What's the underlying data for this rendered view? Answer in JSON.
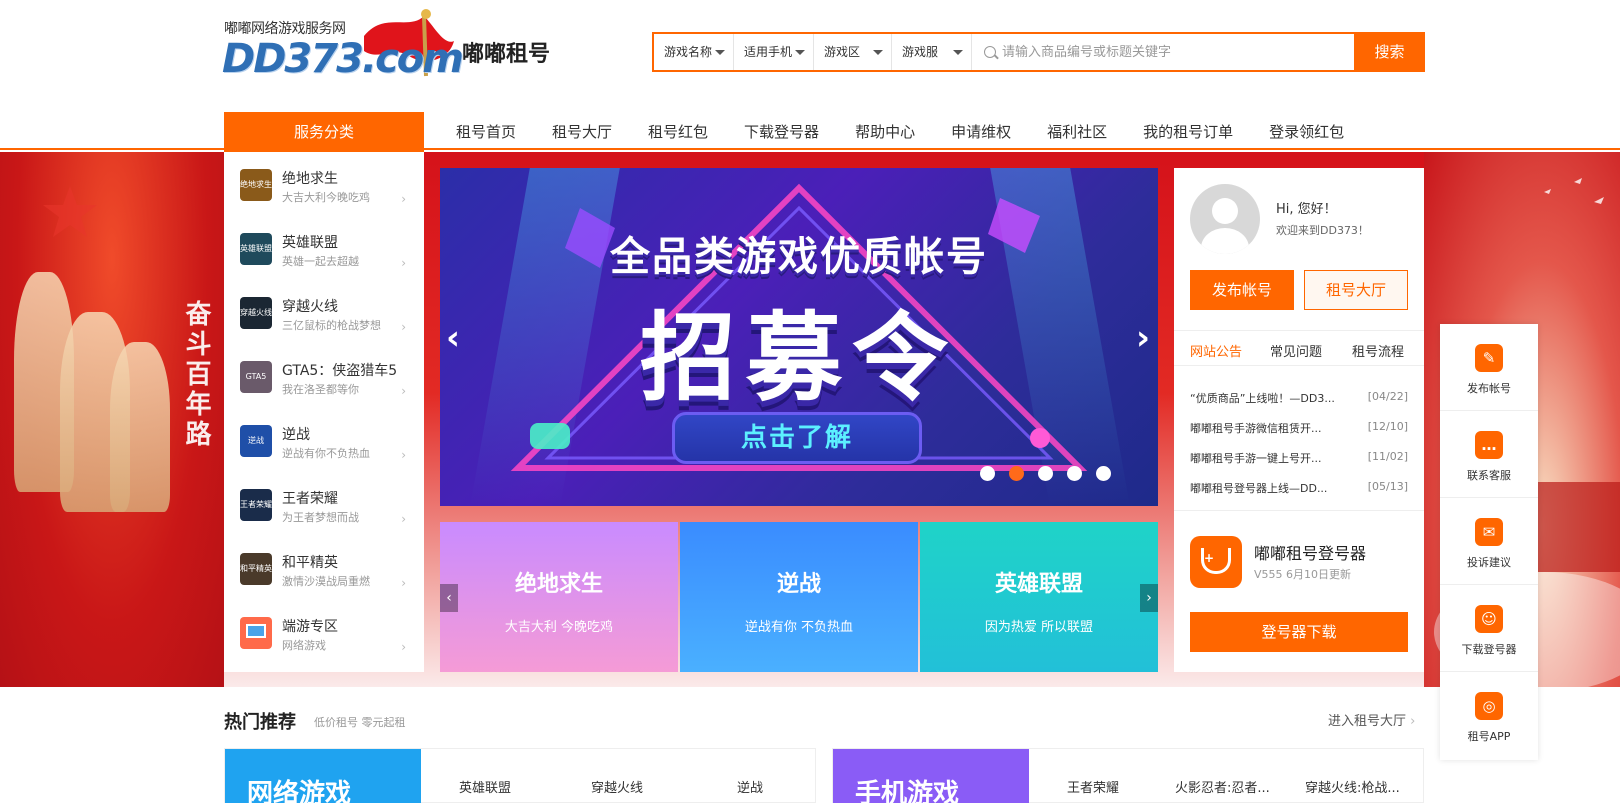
{
  "header": {
    "logo_sub": "嘟嘟网络游戏服务网",
    "logo_main": "DD373.com",
    "brand_title": "嘟嘟租号"
  },
  "search": {
    "filters": [
      "游戏名称",
      "适用手机",
      "游戏区",
      "游戏服"
    ],
    "placeholder": "请输入商品编号或标题关键字",
    "button_label": "搜索"
  },
  "nav": {
    "service_category": "服务分类",
    "links": [
      "租号首页",
      "租号大厅",
      "租号红包",
      "下载登号器",
      "帮助中心",
      "申请维权",
      "福利社区",
      "我的租号订单",
      "登录领红包"
    ]
  },
  "background": {
    "left_slogan": "奋斗百年路"
  },
  "categories": [
    {
      "name": "绝地求生",
      "desc": "大吉大利今晚吃鸡",
      "thumb": "绝地求生",
      "color": "#8a5a1a"
    },
    {
      "name": "英雄联盟",
      "desc": "英雄一起去超越",
      "thumb": "英雄联盟",
      "color": "#1f4a5c"
    },
    {
      "name": "穿越火线",
      "desc": "三亿鼠标的枪战梦想",
      "thumb": "穿越火线",
      "color": "#1b2733"
    },
    {
      "name": "GTA5：侠盗猎车5",
      "desc": "我在洛圣都等你",
      "thumb": "GTA5",
      "color": "#6a5a6a"
    },
    {
      "name": "逆战",
      "desc": "逆战有你不负热血",
      "thumb": "逆战",
      "color": "#1f4fa8"
    },
    {
      "name": "王者荣耀",
      "desc": "为王者梦想而战",
      "thumb": "王者荣耀",
      "color": "#1a2c4a"
    },
    {
      "name": "和平精英",
      "desc": "激情沙漠战局重燃",
      "thumb": "和平精英",
      "color": "#4a3a2a"
    },
    {
      "name": "端游专区",
      "desc": "网络游戏",
      "thumb": "",
      "color": "#ff6a4a"
    }
  ],
  "carousel": {
    "headline": "全品类游戏优质帐号",
    "big_text": "招募令",
    "cta": "点击了解",
    "slide_count": 5,
    "active_slide": 2
  },
  "game_cards": [
    {
      "title": "绝地求生",
      "sub": "大吉大利 今晚吃鸡",
      "color1": "#c98bff",
      "color2": "#f59bd6"
    },
    {
      "title": "逆战",
      "sub": "逆战有你 不负热血",
      "color1": "#3a8cff",
      "color2": "#4ab0ff"
    },
    {
      "title": "英雄联盟",
      "sub": "因为热爱 所以联盟",
      "color1": "#1fd3c8",
      "color2": "#22c0d8"
    }
  ],
  "user_panel": {
    "greeting": "Hi, 您好！",
    "welcome": "欢迎来到DD373！",
    "publish_button": "发布帐号",
    "hall_button": "租号大厅",
    "notice_tabs": [
      "网站公告",
      "常见问题",
      "租号流程"
    ],
    "notices": [
      {
        "title": "“优质商品”上线啦！—DD3...",
        "date": "[04/22]"
      },
      {
        "title": "嘟嘟租号手游微信租赁开...",
        "date": "[12/10]"
      },
      {
        "title": "嘟嘟租号手游一键上号开...",
        "date": "[11/02]"
      },
      {
        "title": "嘟嘟租号登号器上线—DD...",
        "date": "[05/13]"
      }
    ],
    "download_title": "嘟嘟租号登号器",
    "download_version": "V555 6月10日更新",
    "download_button": "登号器下载"
  },
  "side_float": [
    {
      "label": "发布帐号",
      "icon": "edit-icon",
      "glyph": "✎"
    },
    {
      "label": "联系客服",
      "icon": "chat-icon",
      "glyph": "…"
    },
    {
      "label": "投诉建议",
      "icon": "complaint-icon",
      "glyph": "✉"
    },
    {
      "label": "下载登号器",
      "icon": "download-icon",
      "glyph": "☺"
    },
    {
      "label": "租号APP",
      "icon": "app-icon",
      "glyph": "◎"
    }
  ],
  "hot": {
    "title": "热门推荐",
    "subtitle": "低价租号 零元起租",
    "more": "进入租号大厅",
    "blocks": [
      {
        "tile": "网络游戏",
        "color": "#1fa3f0",
        "links": [
          "英雄联盟",
          "穿越火线",
          "逆战"
        ]
      },
      {
        "tile": "手机游戏",
        "color": "#8a5cf6",
        "links": [
          "王者荣耀",
          "火影忍者:忍者...",
          "穿越火线:枪战..."
        ]
      }
    ]
  },
  "colors": {
    "accent": "#ff6600",
    "banner_red": "#d5121a"
  }
}
